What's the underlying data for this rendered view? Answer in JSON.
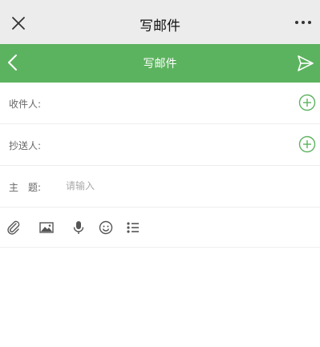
{
  "window": {
    "title": "写邮件",
    "close_icon": "close-icon",
    "more_icon": "more-icon"
  },
  "nav": {
    "title": "写邮件",
    "back_icon": "chevron-left-icon",
    "send_icon": "send-icon",
    "accent": "#5cb35f"
  },
  "form": {
    "to_label": "收件人:",
    "cc_label": "抄送人:",
    "subject_label_a": "主",
    "subject_label_b": "题:",
    "subject_placeholder": "请输入",
    "subject_value": "",
    "add_icon": "plus-circle-icon"
  },
  "toolbar": {
    "items": [
      "attachment-icon",
      "image-icon",
      "microphone-icon",
      "emoji-icon",
      "list-icon"
    ]
  }
}
